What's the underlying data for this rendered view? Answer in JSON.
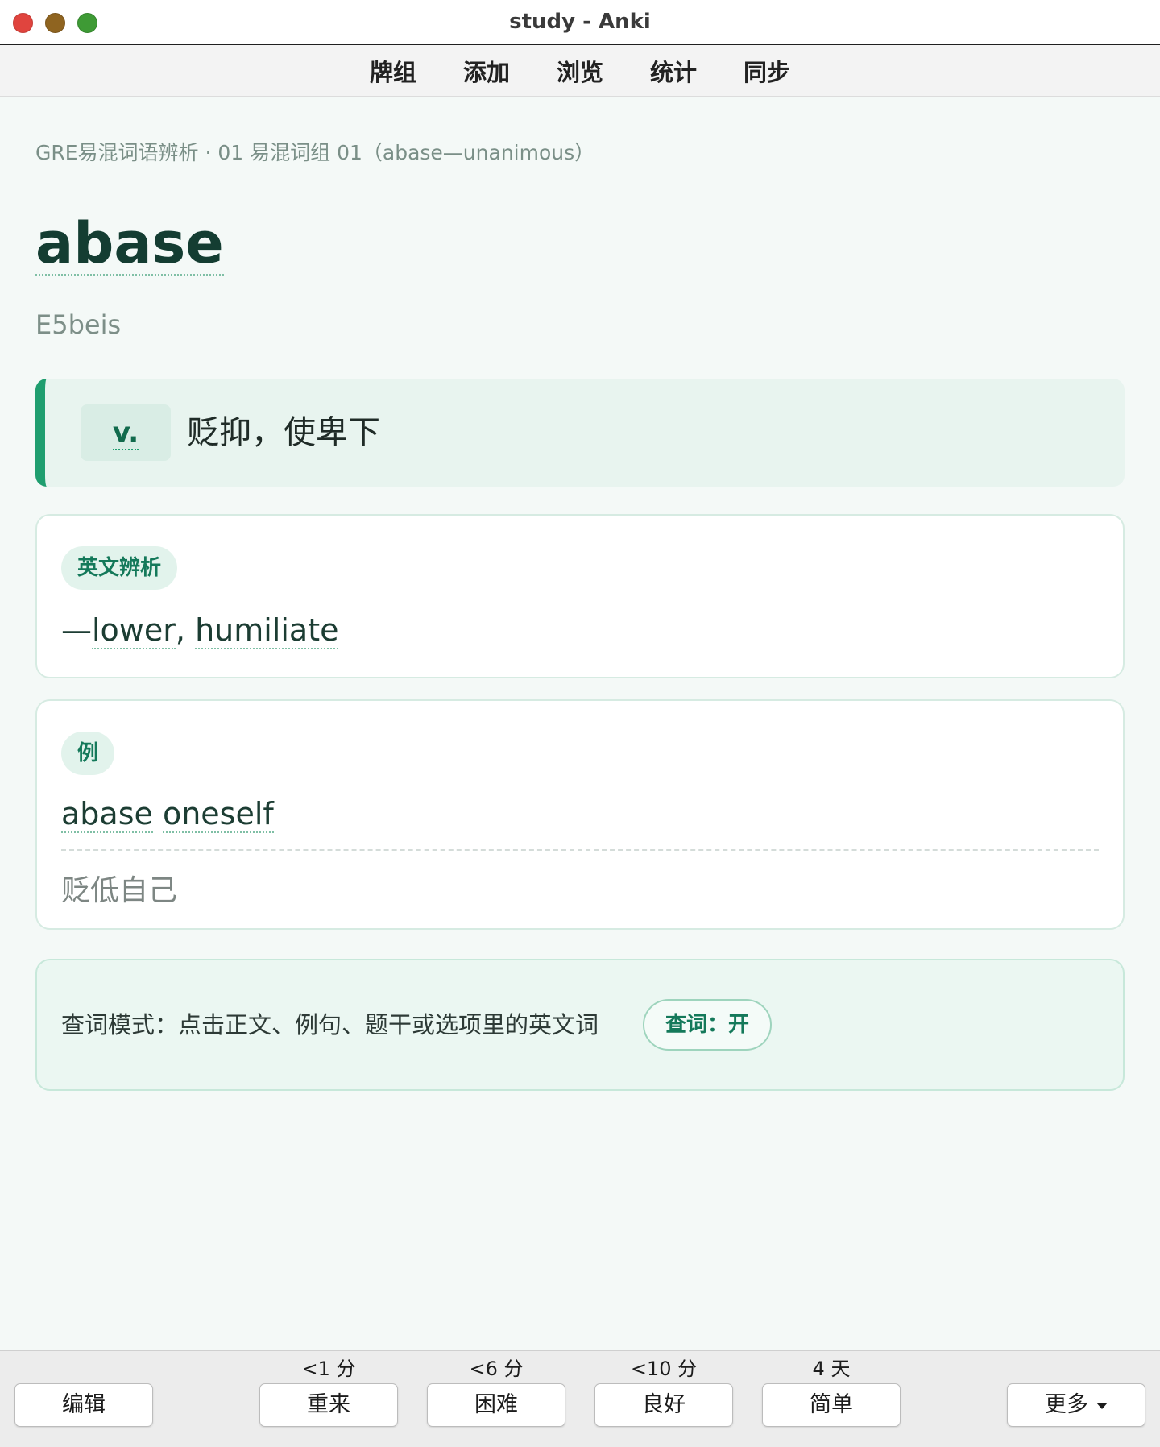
{
  "window": {
    "title": "study - Anki"
  },
  "toolbar": {
    "items": [
      "牌组",
      "添加",
      "浏览",
      "统计",
      "同步"
    ]
  },
  "card": {
    "breadcrumb": "GRE易混词语辨析 · 01 易混词组 01（abase—unanimous）",
    "headword": "abase",
    "phonetic": "E5beis",
    "pos": "v.",
    "meaning": "贬抑，使卑下",
    "analysis": {
      "tag": "英文辨析",
      "prefix": "—",
      "word1": "lower",
      "sep": ", ",
      "word2": "humiliate"
    },
    "example": {
      "tag": "例",
      "word1": "abase",
      "word2": "oneself",
      "translation": "贬低自己"
    },
    "lookup": {
      "text": "查词模式：点击正文、例句、题干或选项里的英文词",
      "button": "查词：开"
    }
  },
  "answer_bar": {
    "edit": "编辑",
    "more": "更多",
    "buttons": [
      {
        "interval": "<1 分",
        "label": "重来"
      },
      {
        "interval": "<6 分",
        "label": "困难"
      },
      {
        "interval": "<10 分",
        "label": "良好"
      },
      {
        "interval": "4 天",
        "label": "简单"
      }
    ]
  },
  "colors": {
    "accent": "#1f9e6f",
    "headword": "#143d32",
    "traffic_red": "#e0443e",
    "traffic_yellow": "#8f6420",
    "traffic_green": "#3e9a35"
  }
}
